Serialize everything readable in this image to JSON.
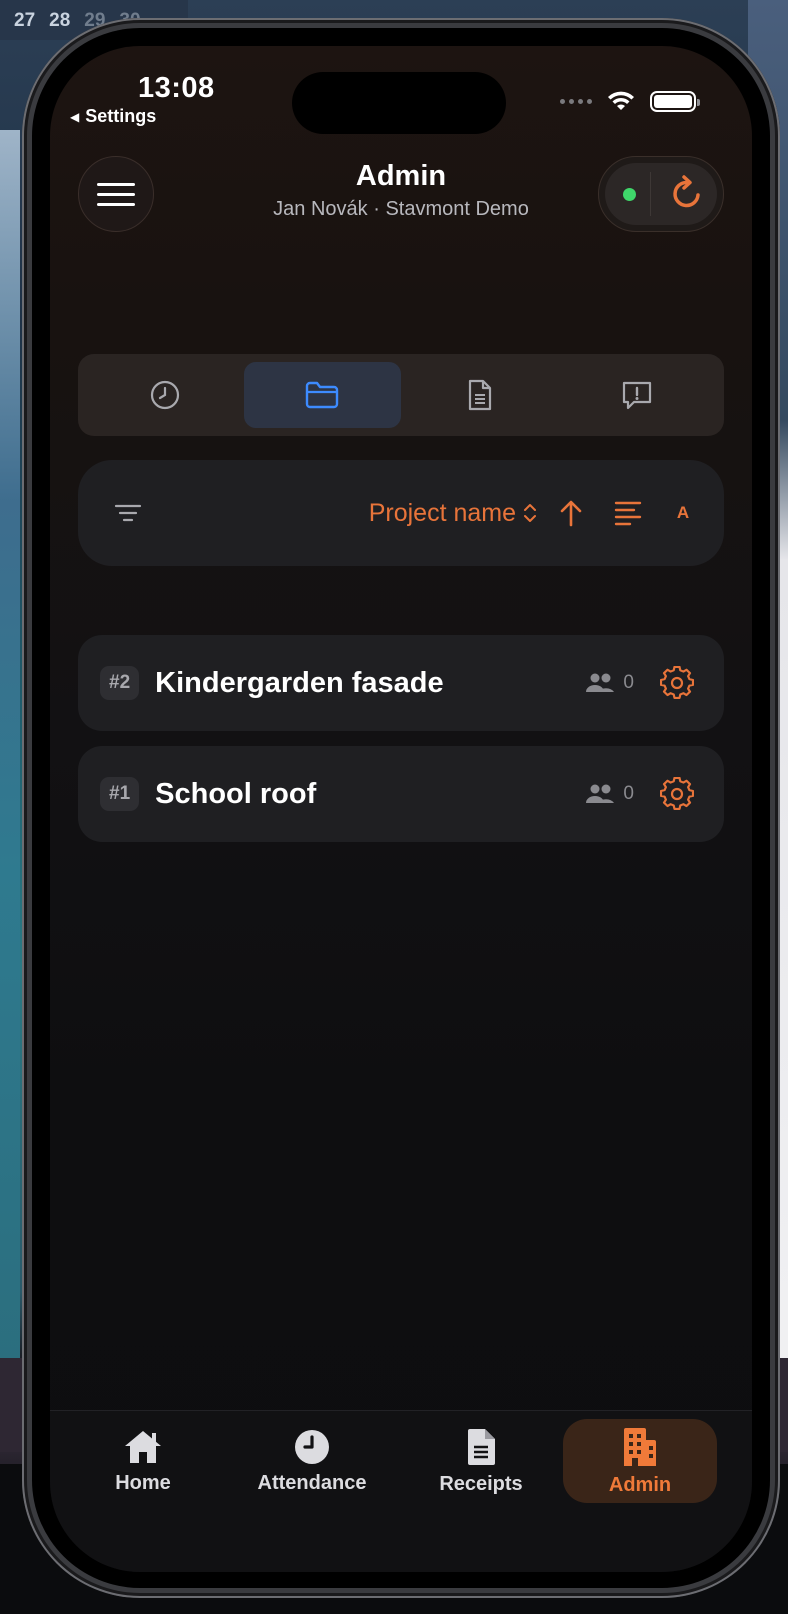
{
  "backdrop": {
    "calendar_days": [
      "27",
      "28",
      "29",
      "30"
    ]
  },
  "status_bar": {
    "time": "13:08",
    "back_label": "Settings"
  },
  "header": {
    "title": "Admin",
    "subtitle": "Jan Novák · Stavmont Demo"
  },
  "segments": [
    {
      "icon": "clock-icon",
      "active": false
    },
    {
      "icon": "folder-icon",
      "active": true
    },
    {
      "icon": "document-icon",
      "active": false
    },
    {
      "icon": "alert-message-icon",
      "active": false
    }
  ],
  "sort_bar": {
    "sort_field": "Project name",
    "direction": "ascending",
    "letter_toggle": "A"
  },
  "projects": [
    {
      "id_label": "#2",
      "name": "Kindergarden fasade",
      "member_count": "0"
    },
    {
      "id_label": "#1",
      "name": "School roof",
      "member_count": "0"
    }
  ],
  "tab_bar": {
    "home": "Home",
    "attendance": "Attendance",
    "receipts": "Receipts",
    "admin": "Admin",
    "active": "admin"
  },
  "colors": {
    "accent": "#e8743a",
    "active_segment_icon": "#3d8bff",
    "online_dot": "#3fd66a"
  }
}
